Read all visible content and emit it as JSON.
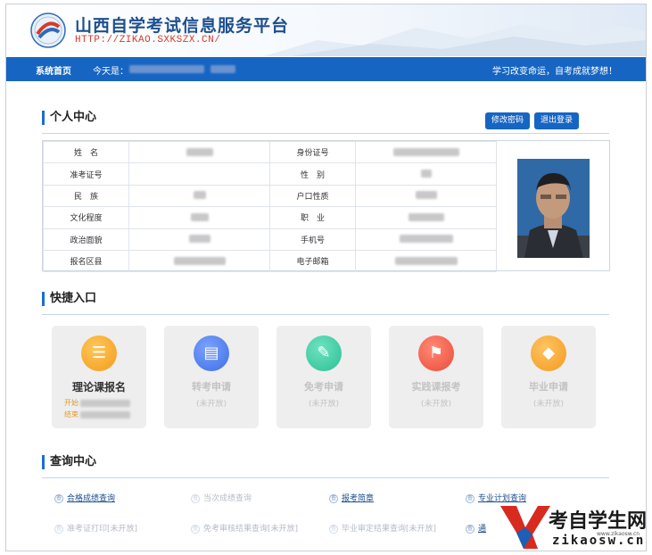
{
  "header": {
    "title": "山西自学考试信息服务平台",
    "url": "HTTP://ZIKAO.SXKSZX.CN/"
  },
  "nav": {
    "home": "系统首页",
    "today_label": "今天是：",
    "slogan": "学习改变命运，自考成就梦想！"
  },
  "profile": {
    "section_title": "个人中心",
    "change_password": "修改密码",
    "logout": "退出登录",
    "rows": [
      {
        "l1": "姓　名",
        "l2": "身份证号"
      },
      {
        "l1": "准考证号",
        "l2": "性　别"
      },
      {
        "l1": "民　族",
        "l2": "户口性质"
      },
      {
        "l1": "文化程度",
        "l2": "职　业"
      },
      {
        "l1": "政治面貌",
        "l2": "手机号"
      },
      {
        "l1": "报名区县",
        "l2": "电子邮箱"
      }
    ]
  },
  "quick": {
    "section_title": "快捷入口",
    "cards": [
      {
        "title": "理论课报名",
        "start": "开始",
        "end": "结束",
        "color": "#f5a623",
        "icon": "stack-icon"
      },
      {
        "title": "转考申请",
        "status": "(未开放)",
        "color": "#4f7fe8",
        "icon": "document-icon"
      },
      {
        "title": "免考申请",
        "status": "(未开放)",
        "color": "#3ec8a2",
        "icon": "edit-icon"
      },
      {
        "title": "实践课报考",
        "status": "(未开放)",
        "color": "#f05a48",
        "icon": "flag-icon"
      },
      {
        "title": "毕业申请",
        "status": "(未开放)",
        "color": "#f4a52c",
        "icon": "graduation-cap-icon"
      }
    ]
  },
  "query": {
    "section_title": "查询中心",
    "links": [
      {
        "text": "合格成绩查询",
        "active": true
      },
      {
        "text": "当次成绩查询",
        "active": false
      },
      {
        "text": "报考简章",
        "active": true
      },
      {
        "text": "专业计划查询",
        "active": true
      },
      {
        "text": "准考证打印[未开放]",
        "active": false
      },
      {
        "text": "免考审核结果查询[未开放]",
        "active": false
      },
      {
        "text": "毕业审定结果查询[未开放]",
        "active": false
      },
      {
        "text": "通",
        "active": true
      }
    ]
  },
  "watermark": {
    "brand": "考自学生网",
    "domain": "zikaosw.cn",
    "small": "www.zikaosw.cn"
  },
  "colors": {
    "primary": "#1765c2",
    "url_red": "#d83a2a"
  }
}
